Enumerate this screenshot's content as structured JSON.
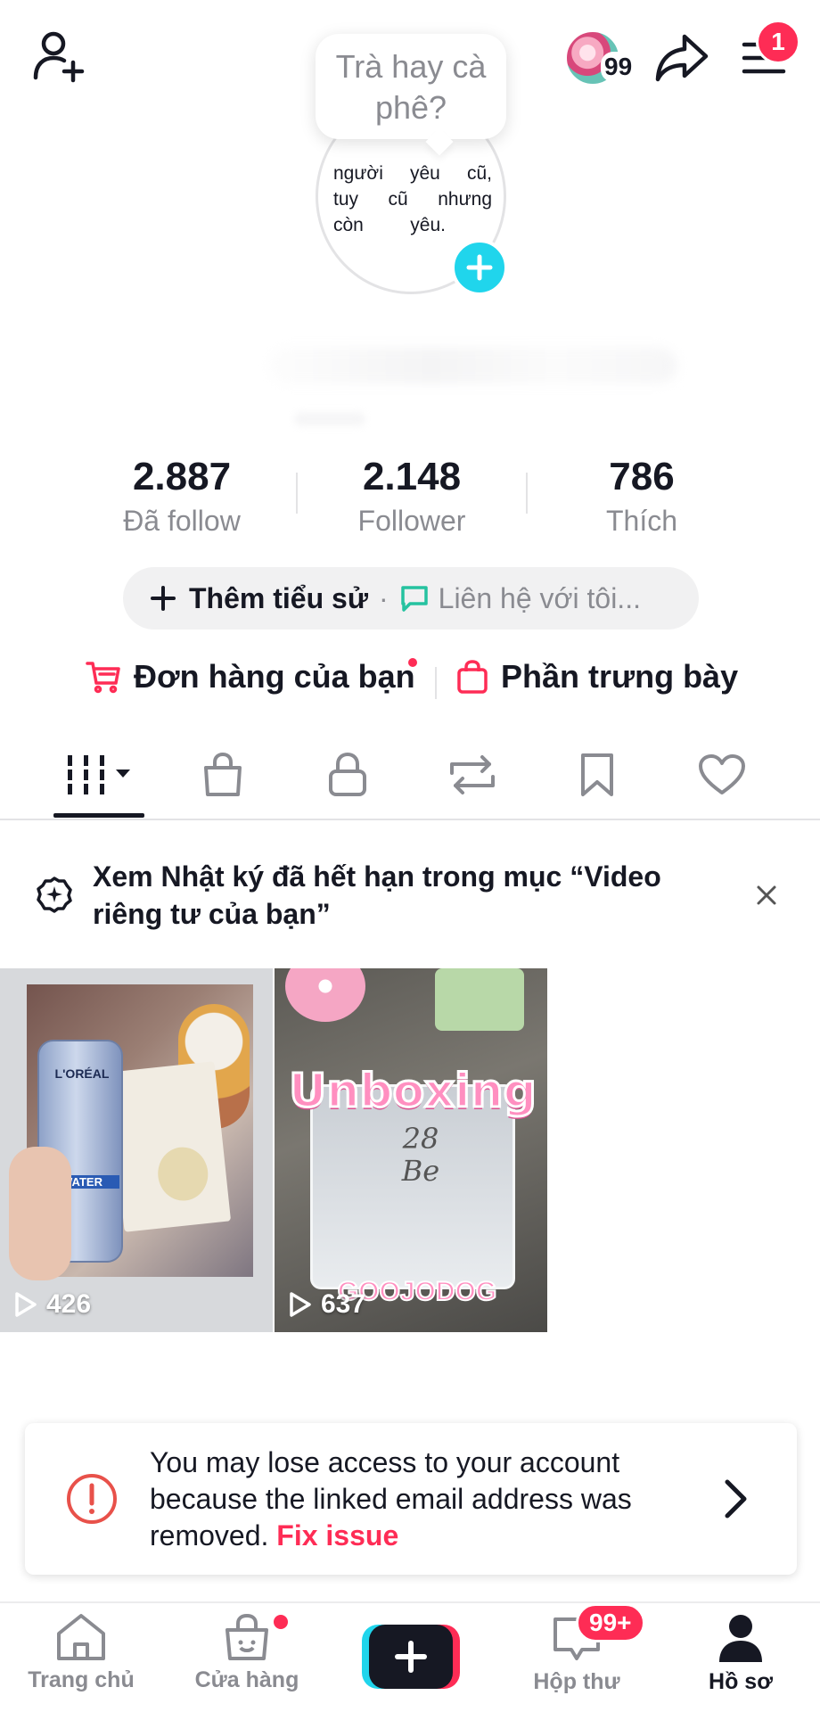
{
  "top_bar": {
    "friend_count": "99",
    "menu_badge": "1"
  },
  "profile": {
    "note": "Trà hay cà phê?",
    "bio_lines": [
      "người yêu cũ,",
      "tuy cũ nhưng",
      "còn yêu."
    ]
  },
  "stats": [
    {
      "value": "2.887",
      "label": "Đã follow"
    },
    {
      "value": "2.148",
      "label": "Follower"
    },
    {
      "value": "786",
      "label": "Thích"
    }
  ],
  "bio_pill": {
    "add_bio": "Thêm tiểu sử",
    "separator": "·",
    "contact": "Liên hệ với tôi..."
  },
  "shop_links": {
    "orders": "Đơn hàng của bạn",
    "showcase": "Phần trưng bày"
  },
  "tabs": [
    "videos-grid-icon",
    "shop-bag-icon",
    "lock-icon",
    "repost-icon",
    "bookmark-icon",
    "heart-icon"
  ],
  "notice": {
    "text": "Xem Nhật ký đã hết hạn trong mục “Video riêng tư của bạn”"
  },
  "videos": [
    {
      "views": "426",
      "brand": "L'ORÉAL",
      "product": "WATER"
    },
    {
      "views": "637",
      "title": "Unboxing",
      "note": "28 Be",
      "caption": "GOOJODOG"
    }
  ],
  "warning": {
    "message": "You may lose access to your account because the linked email address was removed.",
    "action": "Fix issue"
  },
  "bottom_nav": {
    "home": "Trang chủ",
    "shop": "Cửa hàng",
    "inbox": "Hộp thư",
    "inbox_badge": "99+",
    "profile": "Hồ sơ"
  },
  "colors": {
    "accent": "#fe2c55",
    "cyan": "#20d5ec",
    "text": "#161823",
    "muted": "#8a8b91"
  }
}
